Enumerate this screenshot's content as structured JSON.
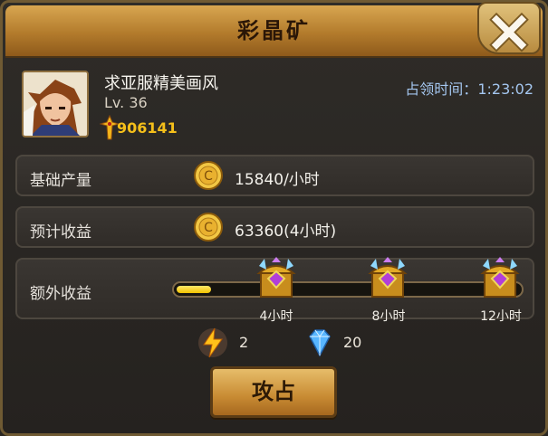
{
  "dialog": {
    "title": "彩晶矿",
    "close_icon": "close-x-icon"
  },
  "player": {
    "name": "求亚服精美画风",
    "level": "Lv. 36",
    "power": "906141",
    "power_icon": "power-cross-icon",
    "occupy_time_label": "占领时间：",
    "occupy_time": "1:23:02"
  },
  "rows": {
    "base_output": {
      "label": "基础产量",
      "value": "15840/小时",
      "icon": "gold-coin-icon"
    },
    "expected_income": {
      "label": "预计收益",
      "value": "63360(4小时)",
      "icon": "gold-coin-icon"
    },
    "extra_income": {
      "label": "额外收益",
      "progress": 0.1,
      "milestones": [
        {
          "label": "4小时",
          "icon": "treasure-chest-icon"
        },
        {
          "label": "8小时",
          "icon": "treasure-chest-icon"
        },
        {
          "label": "12小时",
          "icon": "treasure-chest-icon"
        }
      ]
    }
  },
  "cost": {
    "energy": {
      "icon": "lightning-icon",
      "value": "2"
    },
    "diamond": {
      "icon": "diamond-icon",
      "value": "20"
    }
  },
  "actions": {
    "attack_label": "攻占"
  },
  "colors": {
    "accent_gold": "#f5bf1a",
    "time_blue": "#a4c6ef",
    "panel": "#302c28"
  }
}
